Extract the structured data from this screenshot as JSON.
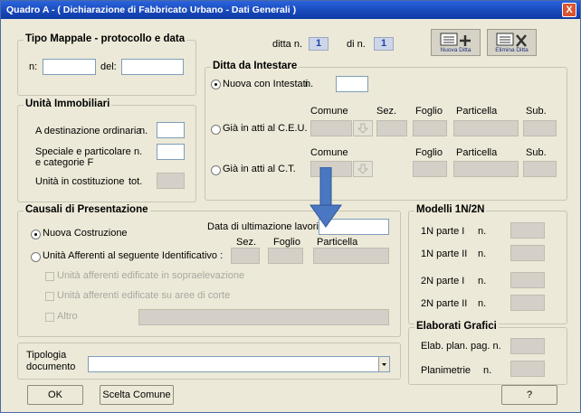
{
  "window": {
    "title": "Quadro A - ( Dichiarazione di Fabbricato Urbano - Dati Generali )",
    "close_label": "X"
  },
  "toolbar": {
    "ditta_label": "ditta n.",
    "ditta_value": "1",
    "di_label": "di n.",
    "di_value": "1",
    "new_ditta_label": "Nuova Ditta",
    "delete_ditta_label": "Elimina Ditta"
  },
  "tipo_mappale": {
    "title": "Tipo Mappale - protocollo e data",
    "n_label": "n:",
    "del_label": "del:",
    "n_value": "",
    "del_value": ""
  },
  "unita": {
    "title": "Unità Immobiliari",
    "ordinaria_label": "A destinazione ordinaria",
    "ordinaria_n": "n.",
    "speciale_label_1": "Speciale e particolare",
    "speciale_label_2": "e categorie F",
    "speciale_n": "n.",
    "costruzione_label": "Unità in costituzione",
    "costruzione_tot": "tot."
  },
  "ditta_intestare": {
    "title": "Ditta da Intestare",
    "nuova_label": "Nuova con Intestati",
    "nuova_n": "n.",
    "col_comune": "Comune",
    "col_sez": "Sez.",
    "col_foglio": "Foglio",
    "col_particella": "Particella",
    "col_sub": "Sub.",
    "ceu_label": "Già in atti al C.E.U.",
    "ct_label": "Già in atti al C.T."
  },
  "causali": {
    "title": "Causali di Presentazione",
    "nuova_costruzione": "Nuova Costruzione",
    "data_label": "Data di ultimazione lavori :",
    "afferenti_label": "Unità Afferenti al seguente Identificativo :",
    "col_sez": "Sez.",
    "col_foglio": "Foglio",
    "col_particella": "Particella",
    "chk1": "Unità afferenti edificate in sopraelevazione",
    "chk2": "Unità afferenti edificate su aree di corte",
    "chk3": "Altro"
  },
  "modelli": {
    "title": "Modelli 1N/2N",
    "r1": "1N parte I",
    "r2": "1N parte II",
    "r3": "2N parte I",
    "r4": "2N parte II",
    "n": "n."
  },
  "elaborati": {
    "title": "Elaborati Grafici",
    "r1": "Elab. plan. pag. n.",
    "r2": "Planimetrie",
    "r2_n": "n."
  },
  "tipologia": {
    "label_1": "Tipologia",
    "label_2": "documento",
    "value": ""
  },
  "buttons": {
    "ok": "OK",
    "scelta": "Scelta Comune",
    "help": "?"
  }
}
